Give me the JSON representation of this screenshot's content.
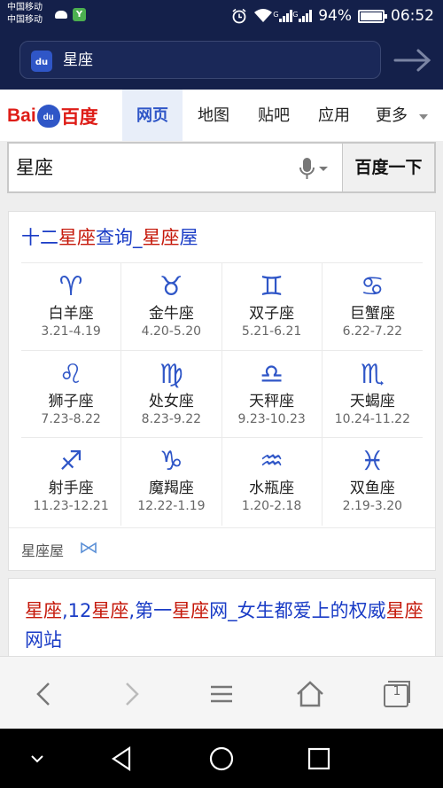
{
  "status": {
    "carrier1": "中国移动",
    "carrier2": "中国移动",
    "app_icon_letter": "Y",
    "battery": "94%",
    "time": "06:52"
  },
  "url_bar": {
    "site_icon_text": "du",
    "text": "星座"
  },
  "nav": {
    "logo_bai": "Bai",
    "logo_du": "du",
    "logo_cn": "百度",
    "tabs": [
      "网页",
      "地图",
      "贴吧",
      "应用",
      "更多"
    ],
    "active_tab": 0
  },
  "search": {
    "query": "星座",
    "button": "百度一下"
  },
  "result1": {
    "title_parts": [
      {
        "text": "十二",
        "hl": false
      },
      {
        "text": "星座",
        "hl": true
      },
      {
        "text": "查询_",
        "hl": false
      },
      {
        "text": "星座",
        "hl": true
      },
      {
        "text": "屋",
        "hl": false
      }
    ],
    "zodiac": [
      {
        "symbol": "♈",
        "name": "白羊座",
        "dates": "3.21-4.19"
      },
      {
        "symbol": "♉",
        "name": "金牛座",
        "dates": "4.20-5.20"
      },
      {
        "symbol": "♊",
        "name": "双子座",
        "dates": "5.21-6.21"
      },
      {
        "symbol": "♋",
        "name": "巨蟹座",
        "dates": "6.22-7.22"
      },
      {
        "symbol": "♌",
        "name": "狮子座",
        "dates": "7.23-8.22"
      },
      {
        "symbol": "♍",
        "name": "处女座",
        "dates": "8.23-9.22"
      },
      {
        "symbol": "♎",
        "name": "天秤座",
        "dates": "9.23-10.23"
      },
      {
        "symbol": "♏",
        "name": "天蝎座",
        "dates": "10.24-11.22"
      },
      {
        "symbol": "♐",
        "name": "射手座",
        "dates": "11.23-12.21"
      },
      {
        "symbol": "♑",
        "name": "魔羯座",
        "dates": "12.22-1.19"
      },
      {
        "symbol": "♒",
        "name": "水瓶座",
        "dates": "1.20-2.18"
      },
      {
        "symbol": "♓",
        "name": "双鱼座",
        "dates": "2.19-3.20"
      }
    ],
    "source": "星座屋"
  },
  "result2": {
    "title_parts": [
      {
        "text": "星座",
        "hl": true
      },
      {
        "text": ",12",
        "hl": false
      },
      {
        "text": "星座",
        "hl": true
      },
      {
        "text": ",第一",
        "hl": false
      },
      {
        "text": "星座",
        "hl": true
      },
      {
        "text": "网_女生都爱上的权威",
        "hl": false
      },
      {
        "text": "星座",
        "hl": true
      },
      {
        "text": "网站",
        "hl": false
      }
    ]
  },
  "toolbar": {
    "tab_count": "1"
  },
  "colors": {
    "brand_blue": "#2f56c7",
    "highlight_red": "#c5180a",
    "link_blue": "#1a3cc6",
    "dark_header": "#14204a"
  }
}
